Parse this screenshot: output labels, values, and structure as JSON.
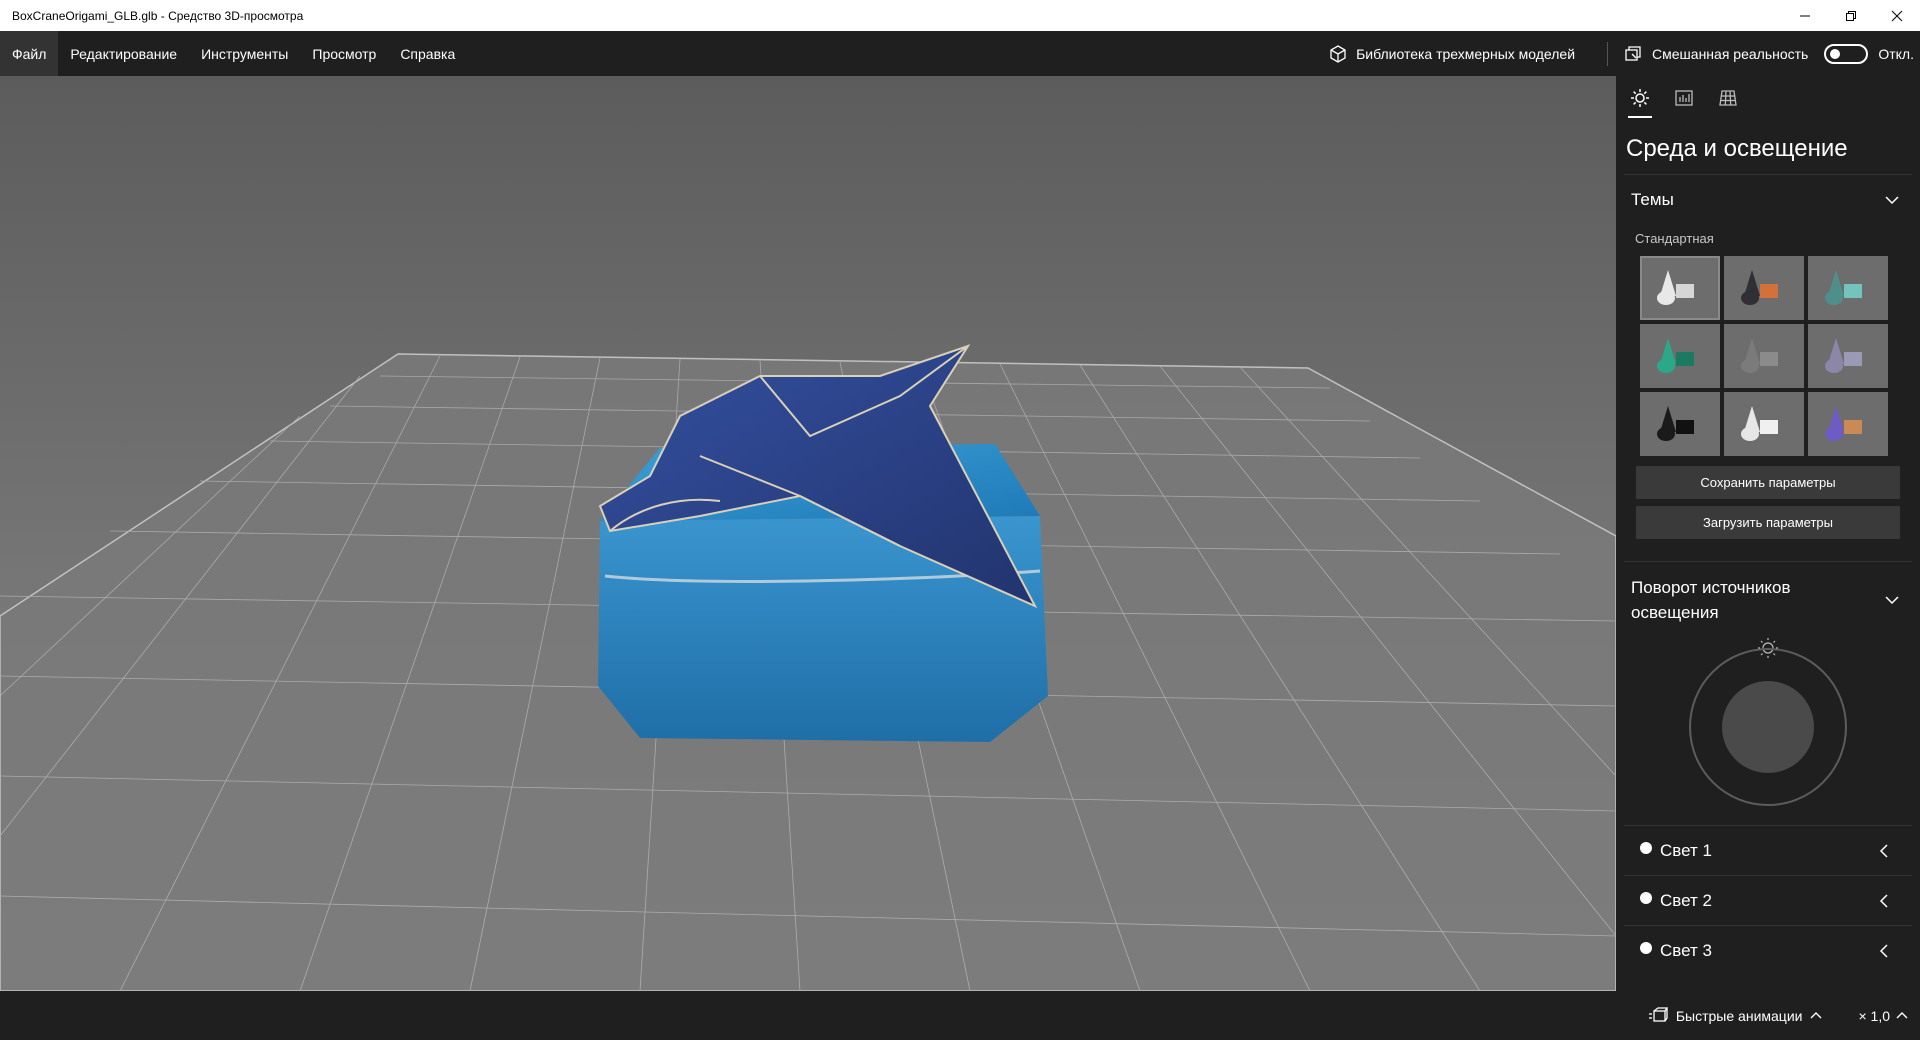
{
  "window": {
    "title": "BoxCraneOrigami_GLB.glb - Средство 3D-просмотра"
  },
  "menu": {
    "items": [
      "Файл",
      "Редактирование",
      "Инструменты",
      "Просмотр",
      "Справка"
    ],
    "library_label": "Библиотека трехмерных моделей",
    "mixed_reality_label": "Смешанная реальность",
    "mixed_reality_state": "Откл."
  },
  "panel": {
    "title": "Среда и освещение",
    "themes_label": "Темы",
    "themes_sublabel": "Стандартная",
    "themes": [
      {
        "name": "theme-white",
        "colors": [
          "#e8e8e8",
          "#d6d6d6"
        ]
      },
      {
        "name": "theme-dark-orange",
        "colors": [
          "#2f2f35",
          "#d4703a"
        ]
      },
      {
        "name": "theme-teal",
        "colors": [
          "#4f8f8b",
          "#74c4bd"
        ]
      },
      {
        "name": "theme-green",
        "colors": [
          "#2aa888",
          "#1c7a62"
        ]
      },
      {
        "name": "theme-grey",
        "colors": [
          "#7b7b7b",
          "#8b8b8b"
        ]
      },
      {
        "name": "theme-lavender",
        "colors": [
          "#8c86a8",
          "#9a9ab4"
        ]
      },
      {
        "name": "theme-black",
        "colors": [
          "#1a1a1a",
          "#111111"
        ]
      },
      {
        "name": "theme-light",
        "colors": [
          "#e6e6e6",
          "#f0f0f0"
        ]
      },
      {
        "name": "theme-purple-orange",
        "colors": [
          "#6e5cc4",
          "#c98a56"
        ]
      }
    ],
    "save_button": "Сохранить параметры",
    "load_button": "Загрузить параметры",
    "rotation_label_line1": "Поворот источников",
    "rotation_label_line2": "освещения",
    "lights": [
      "Свет 1",
      "Свет 2",
      "Свет 3"
    ]
  },
  "bottom": {
    "animations_label": "Быстрые анимации",
    "speed": "× 1,0"
  },
  "colors": {
    "chrome": "#1f1f1f",
    "model_blue": "#2f85c2",
    "crane_navy": "#2b3f84"
  }
}
